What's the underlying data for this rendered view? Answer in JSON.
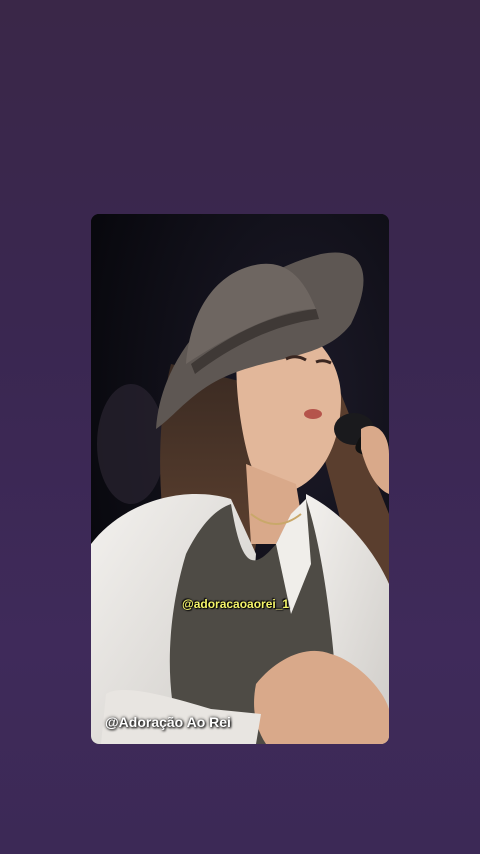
{
  "story": {
    "handle_overlay": "@adoracaoaorei_1",
    "watermark": "@Adoração Ao Rei"
  },
  "colors": {
    "background": "#3a2751",
    "handle_text": "#f4f46a",
    "watermark_text": "#ffffff"
  }
}
